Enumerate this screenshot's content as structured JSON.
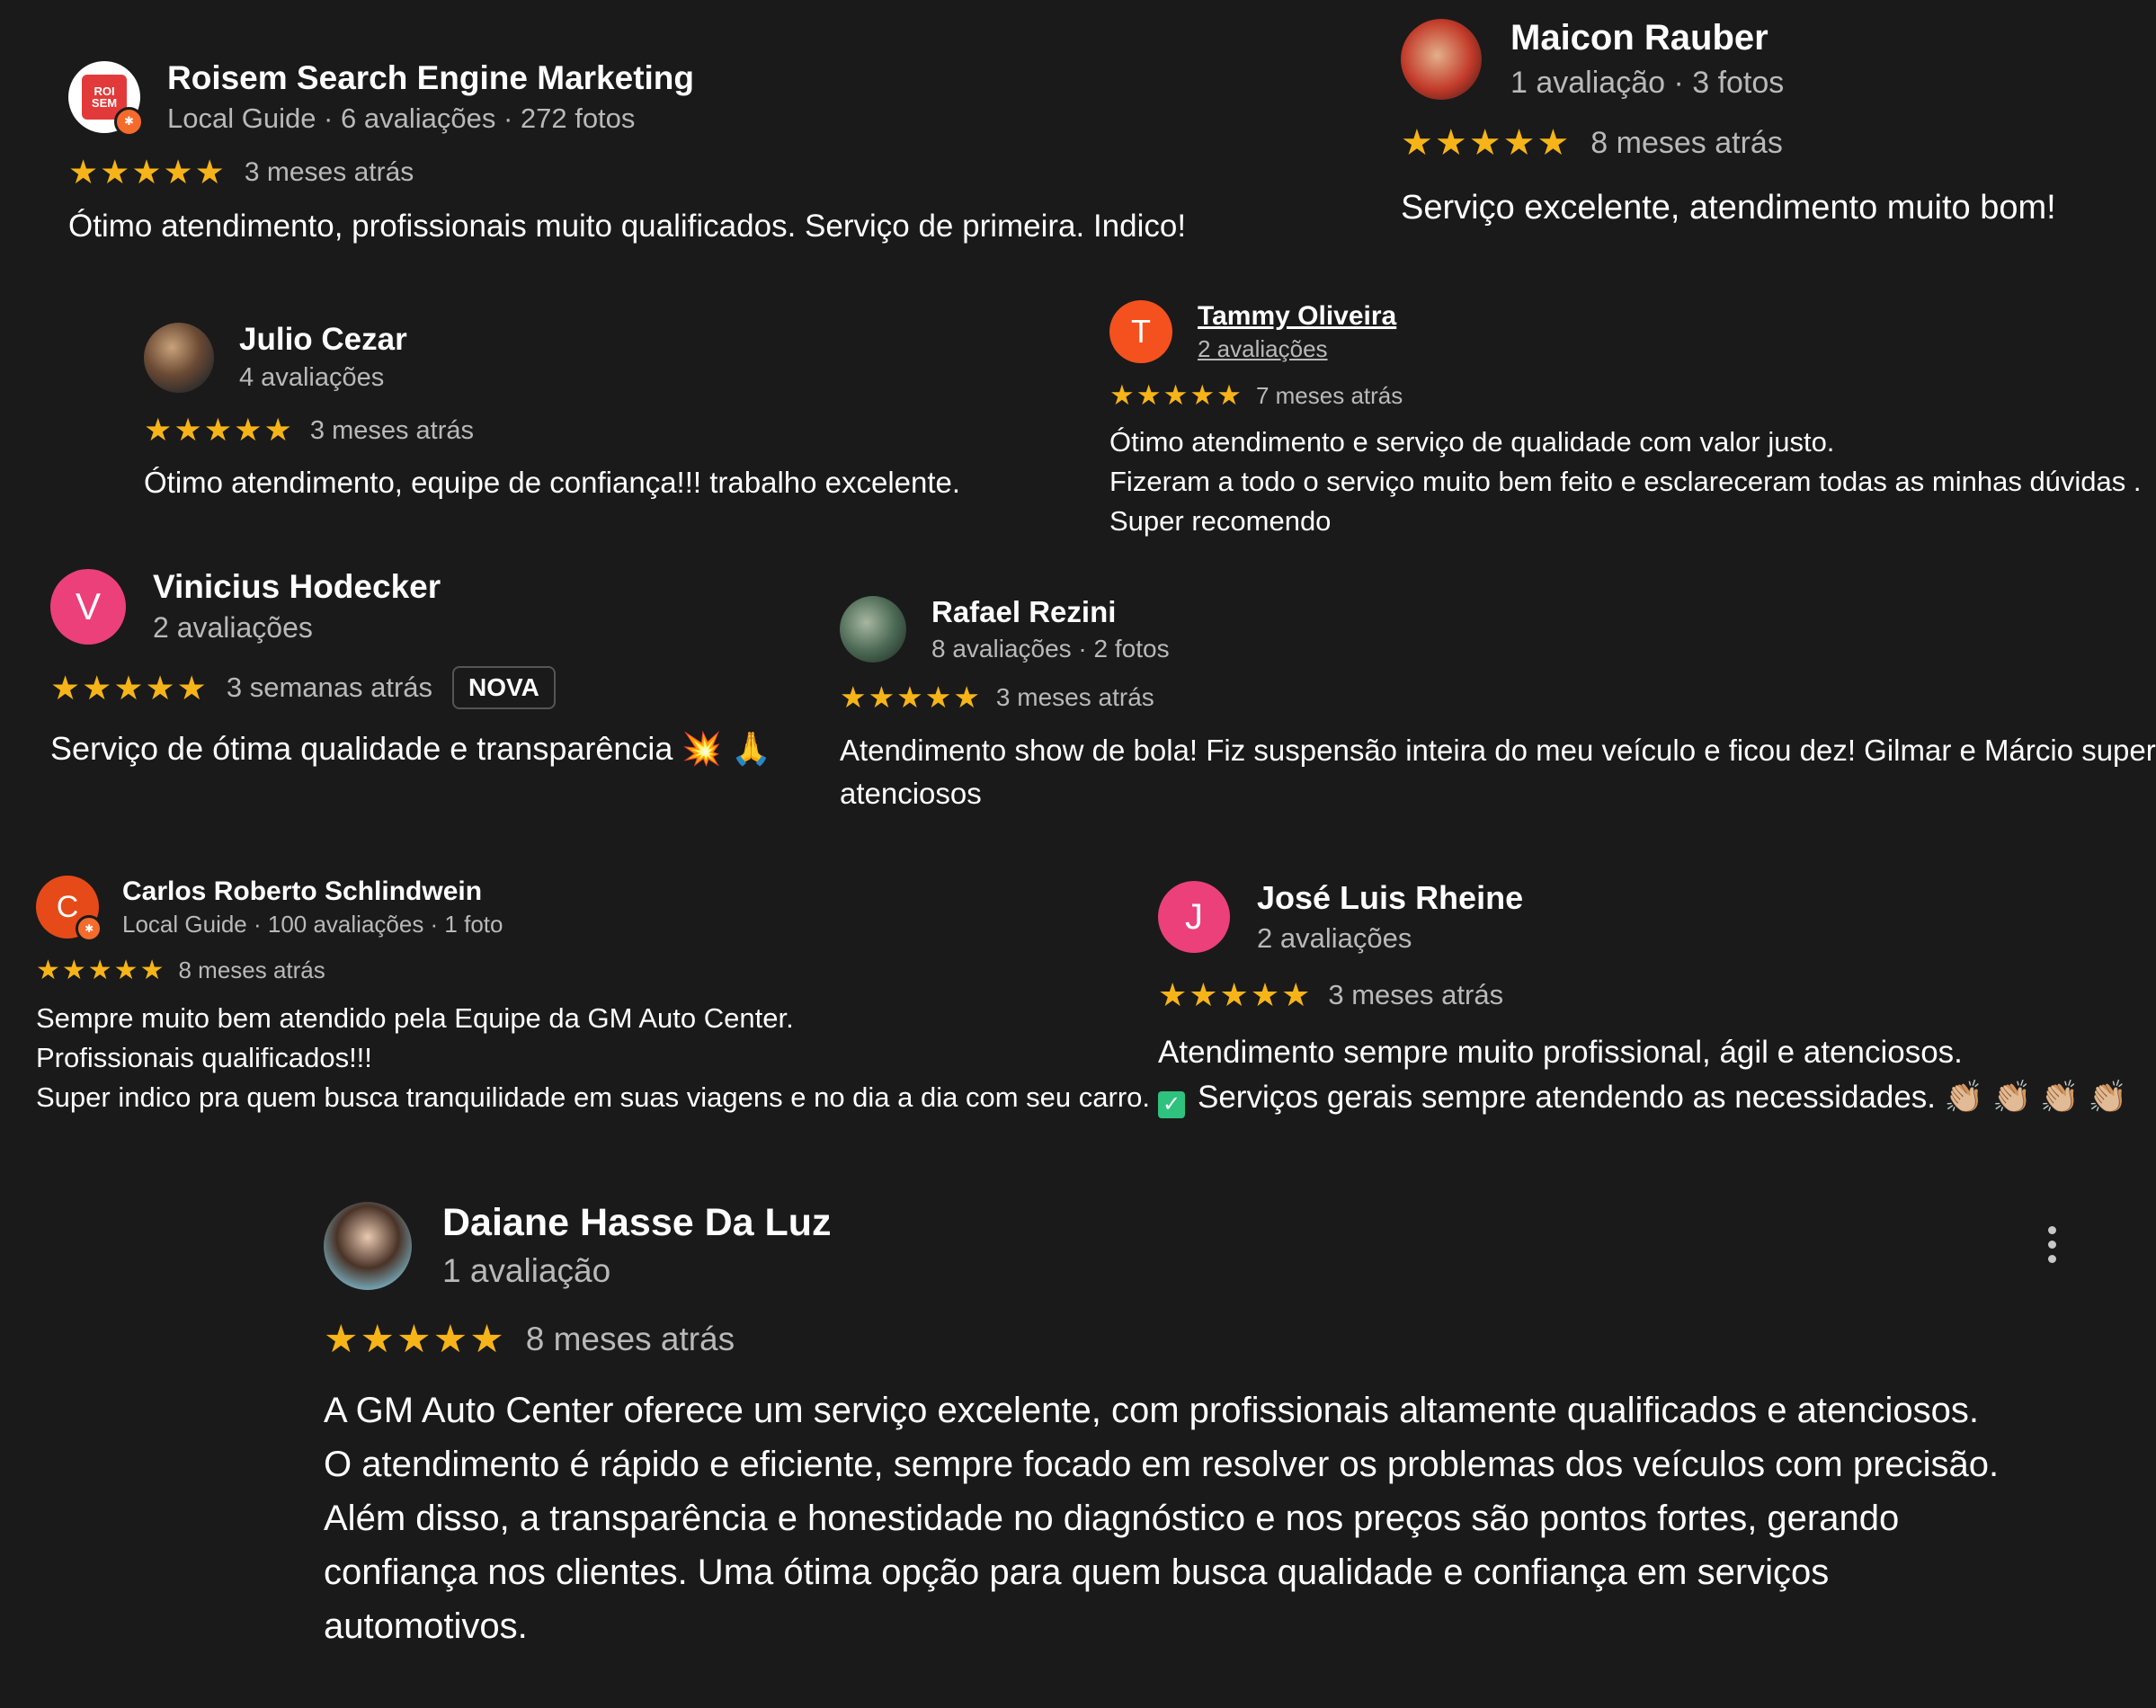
{
  "reviews": [
    {
      "name": "Roisem Search Engine Marketing",
      "meta": "Local Guide · 6 avaliações · 272 fotos",
      "stars": "★★★★★",
      "time": "3 meses atrás",
      "text": [
        "Ótimo atendimento, profissionais muito qualificados. Serviço de primeira. Indico!"
      ],
      "avatar_text": "ROI SEM"
    },
    {
      "name": "Maicon Rauber",
      "meta": "1 avaliação · 3 fotos",
      "stars": "★★★★★",
      "time": "8 meses atrás",
      "text": [
        "Serviço excelente, atendimento muito bom!"
      ]
    },
    {
      "name": "Julio Cezar",
      "meta": "4 avaliações",
      "stars": "★★★★★",
      "time": "3 meses atrás",
      "text": [
        "Ótimo atendimento, equipe de confiança!!! trabalho excelente."
      ]
    },
    {
      "name": "Tammy Oliveira",
      "meta": "2 avaliações",
      "stars": "★★★★★",
      "time": "7 meses atrás",
      "avatar_letter": "T",
      "avatar_color": "#f4511e",
      "text": [
        "Ótimo atendimento e serviço de qualidade com valor justo.",
        "Fizeram a todo o serviço muito bem feito e esclareceram todas as minhas dúvidas .",
        "Super recomendo"
      ]
    },
    {
      "name": "Vinicius Hodecker",
      "meta": "2 avaliações",
      "stars": "★★★★★",
      "time": "3 semanas atrás",
      "badge": "NOVA",
      "avatar_letter": "V",
      "avatar_color": "#ec407a",
      "text": [
        "Serviço de ótima qualidade e transparência 💥 🙏"
      ]
    },
    {
      "name": "Rafael Rezini",
      "meta": "8 avaliações · 2 fotos",
      "stars": "★★★★★",
      "time": "3 meses atrás",
      "text": [
        "Atendimento show de bola! Fiz suspensão inteira do meu veículo e ficou dez! Gilmar e Márcio super",
        "atenciosos"
      ]
    },
    {
      "name": "Carlos Roberto Schlindwein",
      "meta": "Local Guide · 100 avaliações · 1 foto",
      "stars": "★★★★★",
      "time": "8 meses atrás",
      "avatar_letter": "C",
      "avatar_color": "#e64a19",
      "text": [
        "Sempre muito bem atendido pela Equipe da GM Auto Center.",
        "Profissionais qualificados!!!",
        "Super indico pra quem busca tranquilidade em suas viagens e no dia a dia com seu carro."
      ]
    },
    {
      "name": "José Luis Rheine",
      "meta": "2 avaliações",
      "stars": "★★★★★",
      "time": "3 meses atrás",
      "avatar_letter": "J",
      "avatar_color": "#ec407a",
      "text": [
        "Atendimento sempre muito profissional, ágil e atenciosos.",
        "Serviços gerais sempre atendendo as necessidades. 👏🏼 👏🏼 👏🏼 👏🏼"
      ],
      "check": "✓"
    },
    {
      "name": "Daiane Hasse Da Luz",
      "meta": "1 avaliação",
      "stars": "★★★★★",
      "time": "8 meses atrás",
      "text": [
        "A GM Auto Center oferece um serviço excelente, com profissionais altamente qualificados e atenciosos.",
        "O atendimento é rápido e eficiente, sempre focado em resolver os problemas dos veículos com precisão.",
        "Além disso, a transparência e honestidade no diagnóstico e nos preços são pontos fortes, gerando",
        "confiança nos clientes. Uma ótima opção para quem busca qualidade e confiança em serviços",
        "automotivos."
      ]
    }
  ],
  "colors": {
    "background": "#1a1a1a",
    "star": "#f6b418",
    "meta": "#b9b9b9",
    "guide_badge": "#f46b2c"
  },
  "icons": {
    "more": "more-vert-icon",
    "guide": "local-guide-badge-icon",
    "check": "check-box-icon"
  }
}
